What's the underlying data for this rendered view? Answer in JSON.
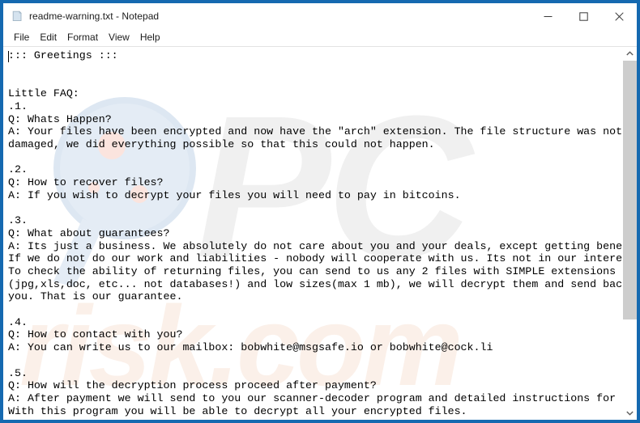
{
  "window": {
    "title": "readme-warning.txt - Notepad",
    "icon": "notepad-document-icon",
    "border_color": "#1569b0",
    "background": "#ffffff"
  },
  "caption_buttons": {
    "minimize": "minimize-icon",
    "maximize": "maximize-icon",
    "close": "close-icon"
  },
  "menubar": {
    "items": [
      {
        "label": "File"
      },
      {
        "label": "Edit"
      },
      {
        "label": "Format"
      },
      {
        "label": "View"
      },
      {
        "label": "Help"
      }
    ]
  },
  "document": {
    "filename": "readme-warning.txt",
    "text": "::: Greetings :::\n\n\nLittle FAQ:\n.1.\nQ: Whats Happen?\nA: Your files have been encrypted and now have the \"arch\" extension. The file structure was not\ndamaged, we did everything possible so that this could not happen.\n\n.2.\nQ: How to recover files?\nA: If you wish to decrypt your files you will need to pay in bitcoins.\n\n.3.\nQ: What about guarantees?\nA: Its just a business. We absolutely do not care about you and your deals, except getting benefits.\nIf we do not do our work and liabilities - nobody will cooperate with us. Its not in our interests.\nTo check the ability of returning files, you can send to us any 2 files with SIMPLE extensions\n(jpg,xls,doc, etc... not databases!) and low sizes(max 1 mb), we will decrypt them and send back to\nyou. That is our guarantee.\n\n.4.\nQ: How to contact with you?\nA: You can write us to our mailbox: bobwhite@msgsafe.io or bobwhite@cock.li\n\n.5.\nQ: How will the decryption process proceed after payment?\nA: After payment we will send to you our scanner-decoder program and detailed instructions for use.\nWith this program you will be able to decrypt all your encrypted files.",
    "contact_emails": [
      "bobwhite@msgsafe.io",
      "bobwhite@cock.li"
    ],
    "file_extension_mentioned": ".arch",
    "payment_method": "bitcoins",
    "free_test_files": "2 files with SIMPLE extensions, max 1 mb"
  },
  "watermark": {
    "logo_text": "PC",
    "site_text": "risk.com",
    "glass_icon": "magnifying-glass-watermark"
  },
  "scrollbar": {
    "up_arrow": "chevron-up-icon",
    "down_arrow": "chevron-down-icon",
    "thumb_position_percent": 0,
    "thumb_size_percent": 75
  }
}
